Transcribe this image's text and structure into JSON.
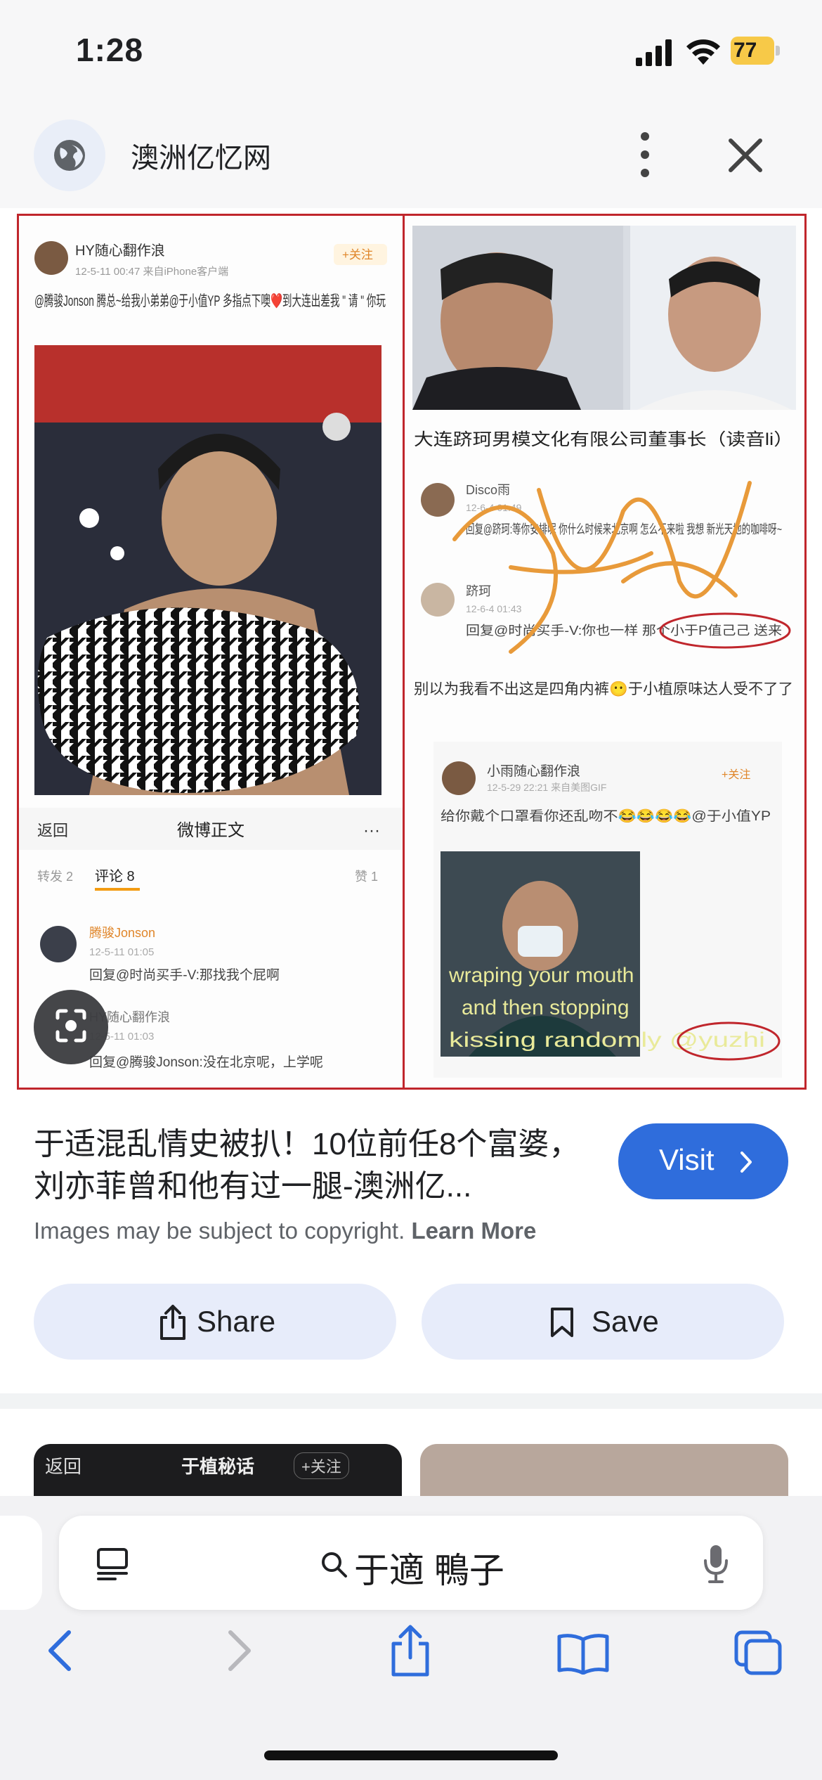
{
  "status": {
    "time": "1:28",
    "battery": "77"
  },
  "header": {
    "site_name": "澳洲亿忆网",
    "site_icon": "globe-icon",
    "more_icon": "more-vert-icon",
    "close_icon": "close-icon"
  },
  "collage": {
    "left": {
      "post_user": "HY随心翻作浪",
      "post_meta": "12-5-11 00:47 来自iPhone客户端",
      "follow": "+关注",
      "post_text": "@腾骏Jonson 腾总~给我小弟弟@于小值YP 多指点下噢❤️到大连出差我 \" 请 \" 你玩",
      "weibo_back": "返回",
      "weibo_title": "微博正文",
      "tab_repost": "转发 2",
      "tab_comment": "评论 8",
      "tab_like": "赞 1",
      "c1_user": "腾骏Jonson",
      "c1_meta": "12-5-11 01:05",
      "c1_text": "回复@时尚买手-V:那找我个屁啊",
      "c2_user": "HY随心翻作浪",
      "c2_meta": "12-5-11 01:03",
      "c2_text": "回复@腾骏Jonson:没在北京呢，上学呢"
    },
    "right": {
      "caption": "大连跻珂男模文化有限公司董事长（读音li）",
      "c1_user": "Disco雨",
      "c1_meta": "12-6-4 01:49",
      "c1_text": "回复@跻珂:等你安排呢 你什么时候来北京啊 怎么不来啦 我想 新光天地的咖啡呀~",
      "c2_user": "跻珂",
      "c2_meta": "12-6-4 01:43",
      "c2_text": "回复@时尚买手-V:你也一样 那个小于P值己己 送来",
      "note": "别以为我看不出这是四角内裤😶于小植原味达人受不了了",
      "p2_user": "小雨随心翻作浪",
      "p2_meta": "12-5-29 22:21 来自美图GIF",
      "p2_follow": "+关注",
      "p2_text": "给你戴个口罩看你还乱吻不😂😂😂😂@于小值YP",
      "sub1": "wraping your mouth",
      "sub2": "and then stopping",
      "sub3": "kissing randomly @yuzhi"
    }
  },
  "result": {
    "title": "于适混乱情史被扒！10位前任8个富婆，刘亦菲曾和他有过一腿-澳洲亿...",
    "visit": "Visit",
    "copyright": "Images may be subject to copyright.",
    "learn_more": "Learn More",
    "share": "Share",
    "save": "Save"
  },
  "thumbs": {
    "t1_back": "返回",
    "t1_title": "于植秘话",
    "t1_follow": "+关注"
  },
  "browser": {
    "query": "于適 鴨子"
  },
  "colors": {
    "accent": "#2f6ddc",
    "pill": "#e7ecfa",
    "frame": "#c0262c"
  }
}
